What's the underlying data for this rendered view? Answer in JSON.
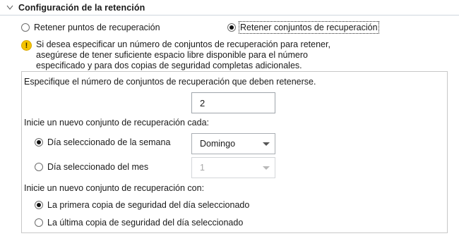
{
  "section": {
    "title": "Configuración de la retención"
  },
  "retention_mode": {
    "option_points": "Retener puntos de recuperación",
    "option_sets": "Retener conjuntos de recuperación",
    "selected": "sets"
  },
  "info": {
    "message": "Si desea especificar un número de conjuntos de recuperación para retener, asegúrese de tener suficiente espacio libre disponible para el número especificado y para dos copias de seguridad completas adicionales."
  },
  "sets_count": {
    "label": "Especifique el número de conjuntos de recuperación que deben retenerse.",
    "value": "2"
  },
  "new_set_every": {
    "label": "Inicie un nuevo conjunto de recuperación cada:",
    "option_weekday": "Día seleccionado de la semana",
    "weekday_value": "Domingo",
    "option_monthday": "Día seleccionado del mes",
    "monthday_value": "1",
    "selected": "weekday"
  },
  "new_set_with": {
    "label": "Inicie un nuevo conjunto de recuperación con:",
    "option_first": "La primera copia de seguridad del día seleccionado",
    "option_last": "La última copia de seguridad del día seleccionado",
    "selected": "first"
  }
}
